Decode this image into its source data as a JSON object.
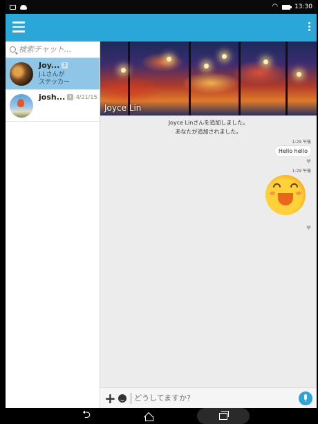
{
  "status_bar": {
    "time": "13:30",
    "left_icons": [
      "screenshot-icon",
      "cloud-upload-icon"
    ],
    "right_icons": [
      "wifi-icon",
      "battery-icon"
    ]
  },
  "app_bar": {
    "menu_icon": "hamburger-menu-icon",
    "overflow_icon": "more-vertical-icon",
    "color": "#2ba6d8"
  },
  "search": {
    "placeholder": "検索チャット..."
  },
  "chat_list": [
    {
      "name": "Joy...",
      "member_count": "2",
      "date": "",
      "preview": "J.Lさんが\nステッカー",
      "selected": true
    },
    {
      "name": "josh...",
      "member_count": "3",
      "date": "4/21/15",
      "preview": "",
      "selected": false
    }
  ],
  "conversation": {
    "cover_title": "Joyce Lin",
    "system_messages": [
      "Joyce Linさんを追加しました。",
      "あなたが追加されました。"
    ],
    "messages": [
      {
        "time": "1:29 午後",
        "text": "Hello hello",
        "type": "text"
      },
      {
        "time": "1:29 午後",
        "text": "",
        "type": "sticker"
      }
    ],
    "heart_glyph": "♥"
  },
  "input_bar": {
    "placeholder": "どうしてますか?",
    "add_glyph": "+",
    "accent": "#2ba6d8"
  },
  "nav_bar": {
    "back_glyph": "⮌"
  }
}
